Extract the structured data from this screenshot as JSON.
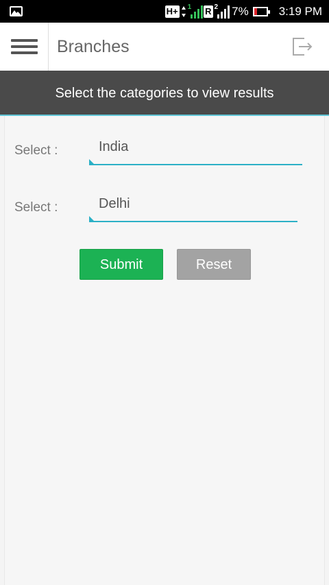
{
  "status_bar": {
    "network_label": "H+",
    "roaming_label": "R",
    "battery_percent": "7%",
    "battery_level": 0.07,
    "time": "3:19 PM",
    "sim_slot_1": "1",
    "sim_slot_2": "2",
    "icons": [
      "gallery-icon",
      "mobile-data-icon",
      "signal-icon",
      "battery-icon"
    ]
  },
  "header": {
    "title": "Branches",
    "menu_icon": "hamburger-menu-icon",
    "logout_icon": "logout-icon"
  },
  "banner": {
    "text": "Select the categories to view results",
    "accent_color": "#5ec5d6"
  },
  "form": {
    "country": {
      "label": "Select :",
      "value": "India"
    },
    "city": {
      "label": "Select :",
      "value": "Delhi"
    },
    "submit_label": "Submit",
    "reset_label": "Reset",
    "submit_color": "#1cb254",
    "reset_color": "#a3a3a3"
  }
}
